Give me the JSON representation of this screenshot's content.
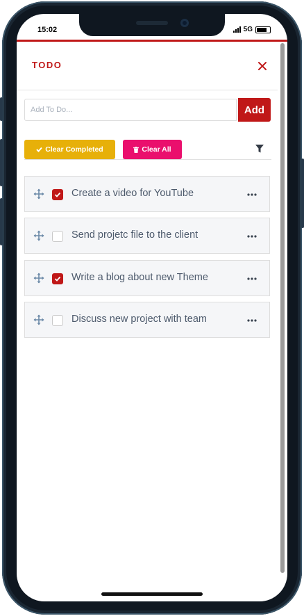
{
  "status": {
    "time": "15:02",
    "network": "5G"
  },
  "header": {
    "title": "TODO"
  },
  "add": {
    "placeholder": "Add To Do...",
    "value": "",
    "button_label": "Add"
  },
  "actions": {
    "clear_completed_label": "Clear Completed",
    "clear_all_label": "Clear All"
  },
  "todos": [
    {
      "text": "Create a video for YouTube",
      "done": true
    },
    {
      "text": "Send projetc file to the client",
      "done": false
    },
    {
      "text": "Write a blog about new Theme",
      "done": true
    },
    {
      "text": "Discuss new project with team",
      "done": false
    }
  ],
  "colors": {
    "accent": "#c01818",
    "warning": "#e7b009",
    "danger": "#ea0f6d",
    "text": "#4d5a6c"
  },
  "icons": [
    "close-icon",
    "check-icon",
    "trash-icon",
    "filter-icon",
    "move-icon",
    "more-icon",
    "battery-icon",
    "signal-icon"
  ]
}
